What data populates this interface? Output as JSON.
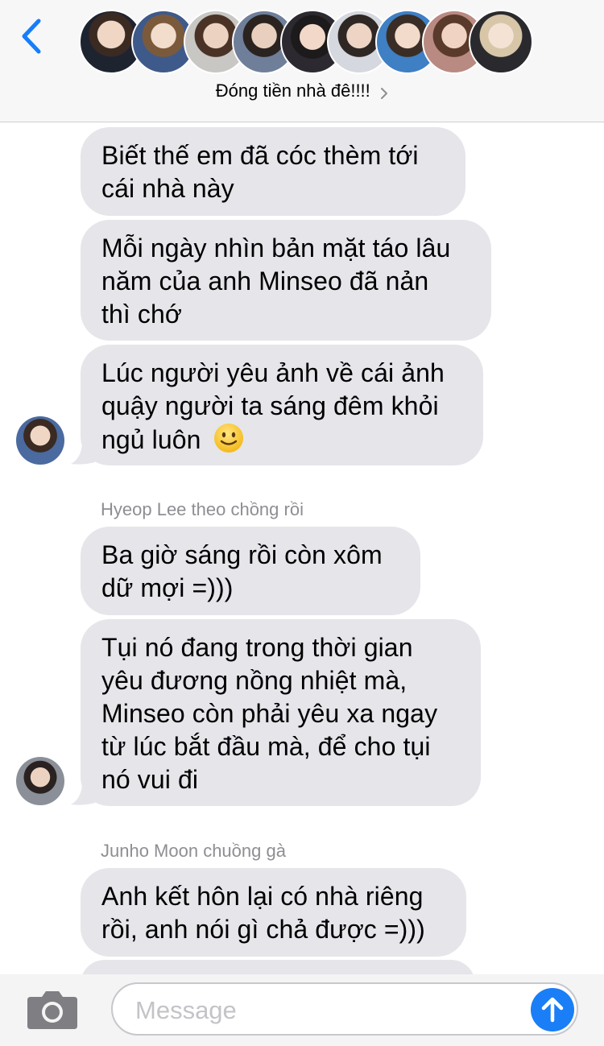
{
  "header": {
    "back_icon": "chevron-left-icon",
    "group_title": "Đóng tiền nhà đê!!!!",
    "group_chevron_icon": "chevron-right-icon",
    "member_avatar_count": 9,
    "accent_color": "#157efb"
  },
  "messages": [
    {
      "type": "bubble",
      "lines": [
        "Biết thế em đã cóc thèm tới",
        "cái nhà này"
      ]
    },
    {
      "type": "bubble",
      "lines": [
        "Mỗi ngày nhìn bản mặt táo lâu",
        "năm của anh Minseo đã nản",
        "thì chớ"
      ]
    },
    {
      "type": "bubble",
      "lines": [
        "Lúc người yêu ảnh về cái ảnh",
        "quậy người ta sáng đêm khỏi",
        "ngủ luôn"
      ],
      "emoji": "slightly-smiling-face-icon"
    },
    {
      "type": "sender",
      "name": "Hyeop Lee theo chồng rồi"
    },
    {
      "type": "bubble",
      "lines": [
        "Ba giờ sáng rồi còn xôm",
        "dữ mợi =)))"
      ]
    },
    {
      "type": "bubble",
      "lines": [
        "Tụi nó đang trong thời gian",
        "yêu đương nồng nhiệt mà,",
        "Minseo còn phải yêu xa ngay",
        "từ lúc bắt đầu mà, để cho tụi",
        "nó vui đi"
      ]
    },
    {
      "type": "sender",
      "name": "Junho Moon chuồng gà"
    },
    {
      "type": "bubble",
      "lines": [
        "Anh kết hôn lại có nhà riêng",
        "rồi, anh nói gì chả được =)))"
      ]
    }
  ],
  "input": {
    "placeholder": "Message",
    "value": "",
    "camera_icon": "camera-icon",
    "send_icon": "arrow-up-icon"
  },
  "colors": {
    "bubble_bg": "#e5e5ea",
    "send_button": "#1a7ef7",
    "sender_text": "#8e8e93"
  }
}
